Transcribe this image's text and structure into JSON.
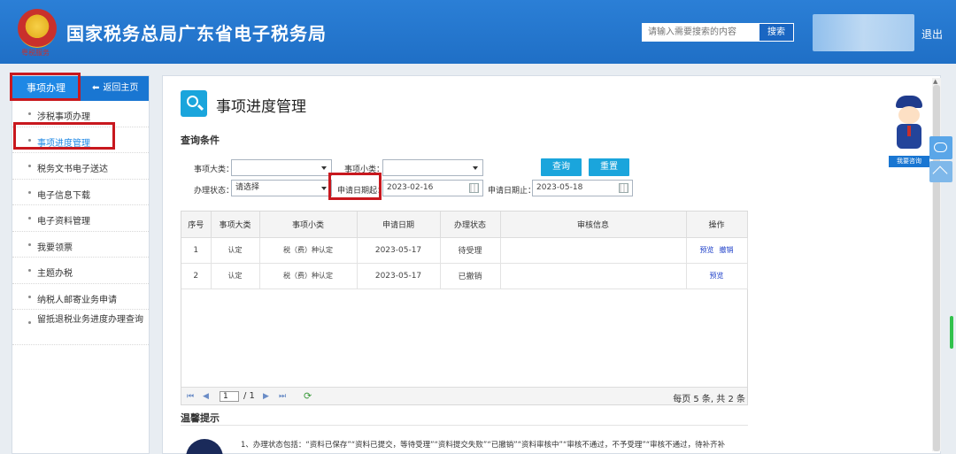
{
  "header": {
    "site_title": "国家税务总局广东省电子税务局",
    "emblem_sub": "粤税服务",
    "search_placeholder": "请输入需要搜索的内容",
    "search_button": "搜索",
    "logout": "退出"
  },
  "sidebar": {
    "tab_label": "事项办理",
    "home_label": "返回主页",
    "items": [
      {
        "label": "涉税事项办理"
      },
      {
        "label": "事项进度管理"
      },
      {
        "label": "税务文书电子送达"
      },
      {
        "label": "电子信息下载"
      },
      {
        "label": "电子资料管理"
      },
      {
        "label": "我要领票"
      },
      {
        "label": "主题办税"
      },
      {
        "label": "纳税人邮寄业务申请"
      },
      {
        "label": "留抵退税业务进度办理查询"
      }
    ]
  },
  "main": {
    "page_title": "事项进度管理",
    "query_section": "查询条件",
    "form": {
      "category_label": "事项大类：",
      "category_value": "",
      "subcategory_label": "事项小类：",
      "subcategory_value": "",
      "status_label": "办理状态：",
      "status_value": "请选择",
      "date_from_label": "申请日期起：",
      "date_from_value": "2023-02-16",
      "date_to_label": "申请日期止：",
      "date_to_value": "2023-05-18",
      "query_button": "查询",
      "reset_button": "重置"
    },
    "table": {
      "headers": [
        "序号",
        "事项大类",
        "事项小类",
        "申请日期",
        "办理状态",
        "审核信息",
        "操作"
      ],
      "rows": [
        {
          "index": "1",
          "category": "认定",
          "subcategory": "税（费）种认定",
          "date": "2023-05-17",
          "status": "待受理",
          "review": "",
          "actions": [
            "预览",
            "撤销"
          ]
        },
        {
          "index": "2",
          "category": "认定",
          "subcategory": "税（费）种认定",
          "date": "2023-05-17",
          "status": "已撤销",
          "review": "",
          "actions": [
            "预览"
          ]
        }
      ]
    },
    "pager": {
      "page": "1",
      "of_total": "/ 1",
      "summary": "每页 5 条, 共 2 条"
    },
    "tips": {
      "title": "温馨提示",
      "text": "1、办理状态包括：“资料已保存”“资料已提交，等待受理”“资料提交失败”“已撤销”“资料审核中”“审核不通过，不予受理”“审核不通过，待补齐补"
    }
  },
  "widgets": {
    "consult_label": "我要咨询"
  },
  "colors": {
    "header_blue": "#1f6fc6",
    "accent_blue": "#1aa5dc",
    "highlight_red": "#c8181e"
  }
}
